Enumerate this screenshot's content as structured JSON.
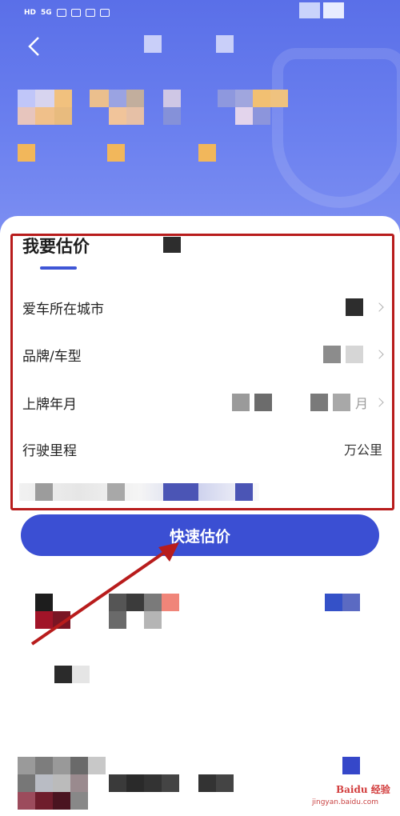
{
  "status_bar": {
    "network": "HD",
    "signal": "5G"
  },
  "form": {
    "title": "我要估价",
    "rows": [
      {
        "label": "爱车所在城市",
        "value": ""
      },
      {
        "label": "品牌/车型",
        "value": ""
      },
      {
        "label": "上牌年月",
        "value": "月"
      },
      {
        "label": "行驶里程",
        "value": "万公里"
      }
    ]
  },
  "cta": {
    "label": "快速估价"
  },
  "watermark": {
    "brand": "Baidu 经验",
    "url": "jingyan.baidu.com"
  },
  "colors": {
    "accent": "#3b4fd3",
    "header_top": "#5a6fe8",
    "highlight_box": "#b81c1c",
    "arrow": "#b81c1c"
  }
}
